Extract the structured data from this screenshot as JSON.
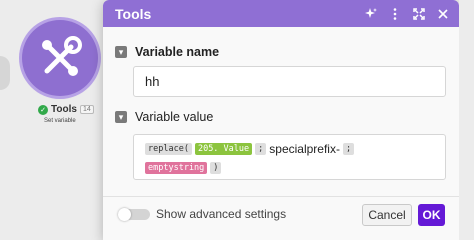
{
  "node": {
    "title": "Tools",
    "badge": "14",
    "subtitle": "Set variable",
    "icon": "wrench-screwdriver-icon",
    "color": "#8e6fd0"
  },
  "modal": {
    "title": "Tools",
    "header_color": "#8f6fd4",
    "header_icons": [
      "sparkle-icon",
      "more-vert-icon",
      "expand-icon",
      "close-icon"
    ],
    "fields": {
      "name_label": "Variable name",
      "name_value": "hh",
      "value_label": "Variable value",
      "expression": {
        "fn_open": "replace(",
        "var_token": "205. Value",
        "sep1": ";",
        "text1": "specialprefix-",
        "sep2": ";",
        "kw_token": "emptystring",
        "fn_close": ")"
      }
    },
    "footer": {
      "advanced_label": "Show advanced settings",
      "advanced_enabled": false,
      "cancel_label": "Cancel",
      "ok_label": "OK",
      "ok_color": "#6419d6"
    }
  }
}
